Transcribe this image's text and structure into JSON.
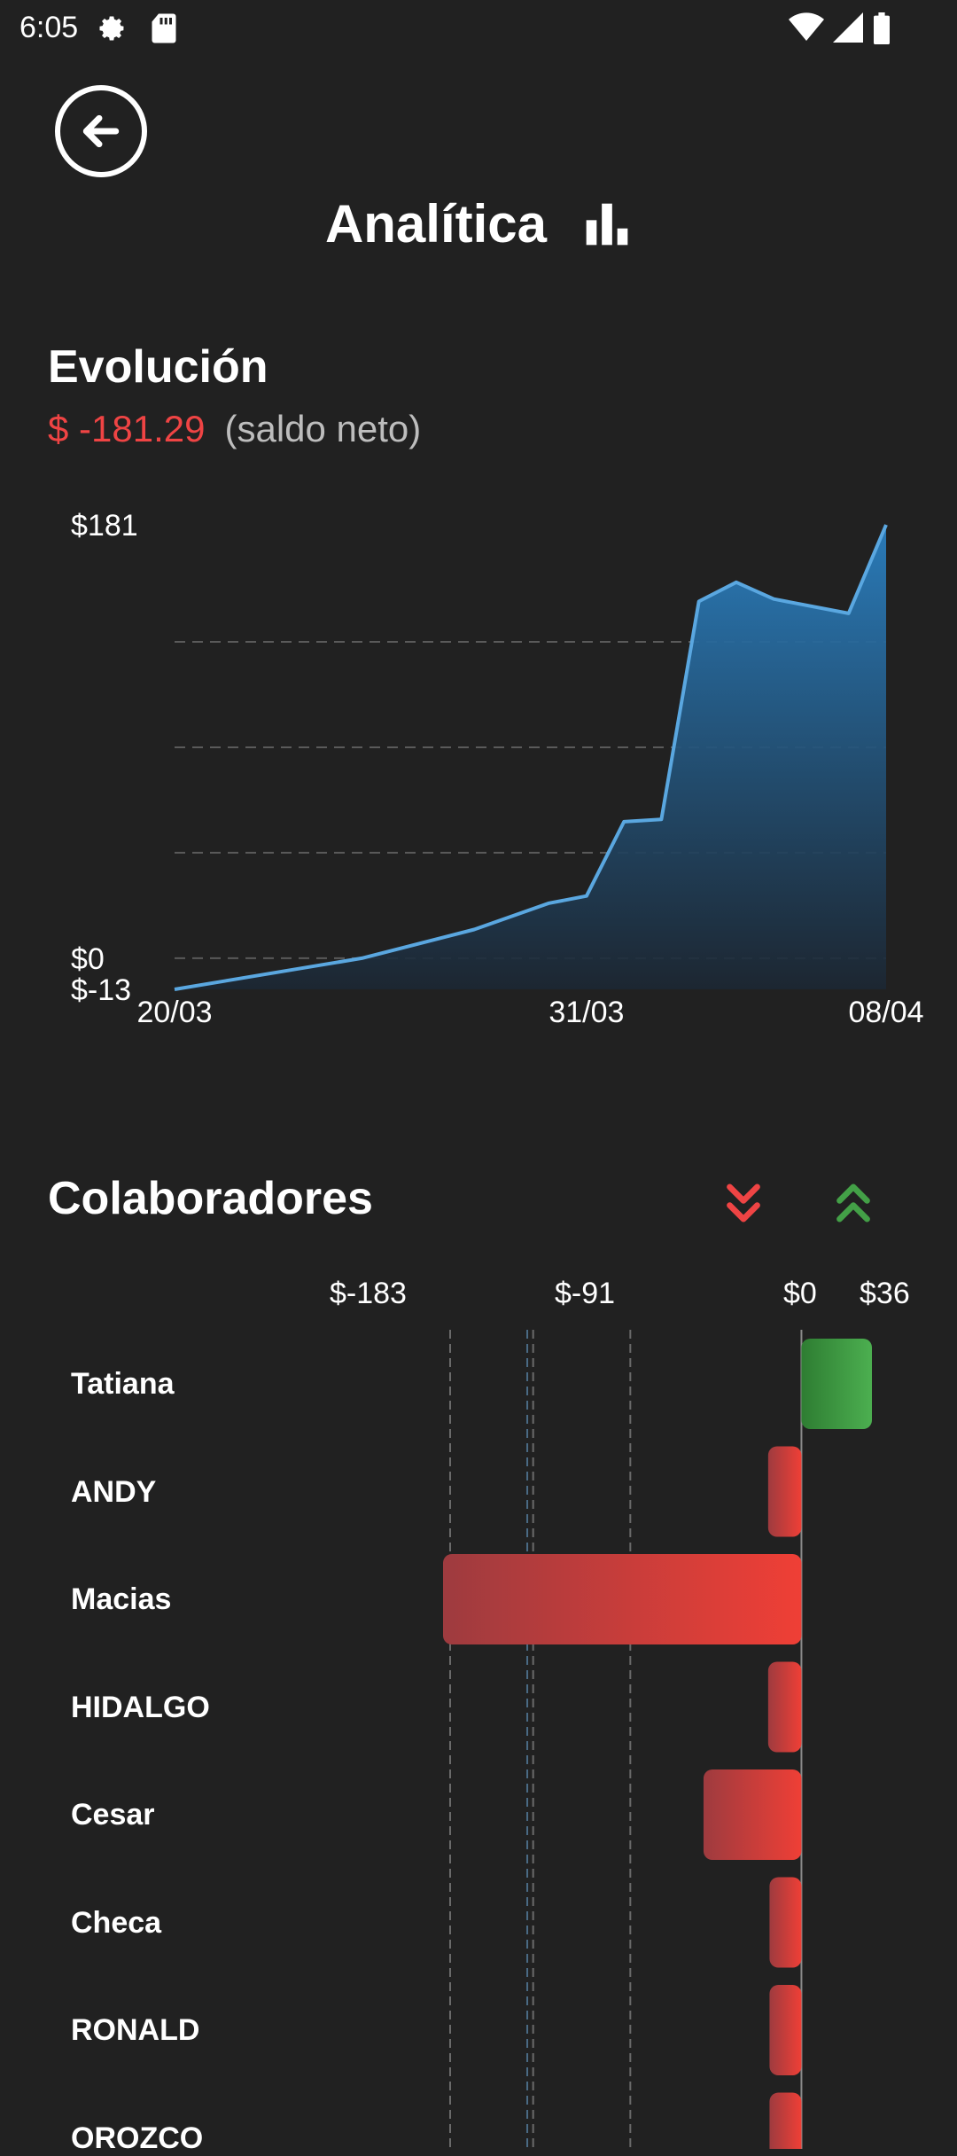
{
  "status_bar": {
    "time": "6:05"
  },
  "header": {
    "title": "Analítica"
  },
  "evolution": {
    "title": "Evolución",
    "net_amount": "$ -181.29",
    "net_label": "(saldo neto)"
  },
  "chart_data": [
    {
      "type": "area",
      "title": "Evolución",
      "x_ticks": [
        "20/03",
        "31/03",
        "08/04"
      ],
      "y_ticks": [
        "$181",
        "$0",
        "$-13"
      ],
      "ylim": [
        -13,
        181
      ],
      "grid": true,
      "x": [
        "20/03",
        "25/03",
        "28/03",
        "30/03",
        "31/03",
        "01/04",
        "02/04",
        "03/04",
        "04/04",
        "05/04",
        "07/04",
        "08/04"
      ],
      "values": [
        -13,
        0,
        12,
        23,
        26,
        57,
        58,
        149,
        157,
        150,
        144,
        181
      ]
    },
    {
      "type": "bar",
      "title": "Colaboradores",
      "x_ticks": [
        "$-183",
        "$-91",
        "$0",
        "$36"
      ],
      "xlim": [
        -183,
        36
      ],
      "categories": [
        "Tatiana",
        "ANDY",
        "Macias",
        "HIDALGO",
        "Cesar",
        "Checa",
        "RONALD",
        "OROZCO"
      ],
      "values": [
        36,
        -17,
        -183,
        -17,
        -50,
        -13,
        -11,
        -11
      ]
    }
  ],
  "collaborators": {
    "title": "Colaboradores",
    "sort_desc_icon": "double-chevron-down-icon",
    "sort_asc_icon": "double-chevron-up-icon"
  },
  "colors": {
    "background": "#212121",
    "negative": "#ef4444",
    "positive": "#43a047",
    "line": "#5aa7e0"
  }
}
